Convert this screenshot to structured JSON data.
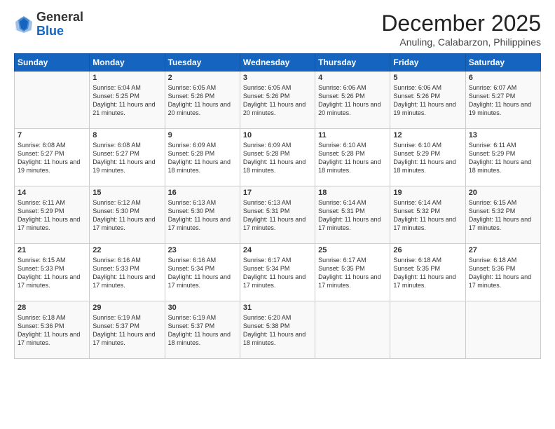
{
  "header": {
    "logo_general": "General",
    "logo_blue": "Blue",
    "month_title": "December 2025",
    "location": "Anuling, Calabarzon, Philippines"
  },
  "columns": [
    "Sunday",
    "Monday",
    "Tuesday",
    "Wednesday",
    "Thursday",
    "Friday",
    "Saturday"
  ],
  "weeks": [
    [
      {
        "day": "",
        "sunrise": "",
        "sunset": "",
        "daylight": ""
      },
      {
        "day": "1",
        "sunrise": "Sunrise: 6:04 AM",
        "sunset": "Sunset: 5:25 PM",
        "daylight": "Daylight: 11 hours and 21 minutes."
      },
      {
        "day": "2",
        "sunrise": "Sunrise: 6:05 AM",
        "sunset": "Sunset: 5:26 PM",
        "daylight": "Daylight: 11 hours and 20 minutes."
      },
      {
        "day": "3",
        "sunrise": "Sunrise: 6:05 AM",
        "sunset": "Sunset: 5:26 PM",
        "daylight": "Daylight: 11 hours and 20 minutes."
      },
      {
        "day": "4",
        "sunrise": "Sunrise: 6:06 AM",
        "sunset": "Sunset: 5:26 PM",
        "daylight": "Daylight: 11 hours and 20 minutes."
      },
      {
        "day": "5",
        "sunrise": "Sunrise: 6:06 AM",
        "sunset": "Sunset: 5:26 PM",
        "daylight": "Daylight: 11 hours and 19 minutes."
      },
      {
        "day": "6",
        "sunrise": "Sunrise: 6:07 AM",
        "sunset": "Sunset: 5:27 PM",
        "daylight": "Daylight: 11 hours and 19 minutes."
      }
    ],
    [
      {
        "day": "7",
        "sunrise": "Sunrise: 6:08 AM",
        "sunset": "Sunset: 5:27 PM",
        "daylight": "Daylight: 11 hours and 19 minutes."
      },
      {
        "day": "8",
        "sunrise": "Sunrise: 6:08 AM",
        "sunset": "Sunset: 5:27 PM",
        "daylight": "Daylight: 11 hours and 19 minutes."
      },
      {
        "day": "9",
        "sunrise": "Sunrise: 6:09 AM",
        "sunset": "Sunset: 5:28 PM",
        "daylight": "Daylight: 11 hours and 18 minutes."
      },
      {
        "day": "10",
        "sunrise": "Sunrise: 6:09 AM",
        "sunset": "Sunset: 5:28 PM",
        "daylight": "Daylight: 11 hours and 18 minutes."
      },
      {
        "day": "11",
        "sunrise": "Sunrise: 6:10 AM",
        "sunset": "Sunset: 5:28 PM",
        "daylight": "Daylight: 11 hours and 18 minutes."
      },
      {
        "day": "12",
        "sunrise": "Sunrise: 6:10 AM",
        "sunset": "Sunset: 5:29 PM",
        "daylight": "Daylight: 11 hours and 18 minutes."
      },
      {
        "day": "13",
        "sunrise": "Sunrise: 6:11 AM",
        "sunset": "Sunset: 5:29 PM",
        "daylight": "Daylight: 11 hours and 18 minutes."
      }
    ],
    [
      {
        "day": "14",
        "sunrise": "Sunrise: 6:11 AM",
        "sunset": "Sunset: 5:29 PM",
        "daylight": "Daylight: 11 hours and 17 minutes."
      },
      {
        "day": "15",
        "sunrise": "Sunrise: 6:12 AM",
        "sunset": "Sunset: 5:30 PM",
        "daylight": "Daylight: 11 hours and 17 minutes."
      },
      {
        "day": "16",
        "sunrise": "Sunrise: 6:13 AM",
        "sunset": "Sunset: 5:30 PM",
        "daylight": "Daylight: 11 hours and 17 minutes."
      },
      {
        "day": "17",
        "sunrise": "Sunrise: 6:13 AM",
        "sunset": "Sunset: 5:31 PM",
        "daylight": "Daylight: 11 hours and 17 minutes."
      },
      {
        "day": "18",
        "sunrise": "Sunrise: 6:14 AM",
        "sunset": "Sunset: 5:31 PM",
        "daylight": "Daylight: 11 hours and 17 minutes."
      },
      {
        "day": "19",
        "sunrise": "Sunrise: 6:14 AM",
        "sunset": "Sunset: 5:32 PM",
        "daylight": "Daylight: 11 hours and 17 minutes."
      },
      {
        "day": "20",
        "sunrise": "Sunrise: 6:15 AM",
        "sunset": "Sunset: 5:32 PM",
        "daylight": "Daylight: 11 hours and 17 minutes."
      }
    ],
    [
      {
        "day": "21",
        "sunrise": "Sunrise: 6:15 AM",
        "sunset": "Sunset: 5:33 PM",
        "daylight": "Daylight: 11 hours and 17 minutes."
      },
      {
        "day": "22",
        "sunrise": "Sunrise: 6:16 AM",
        "sunset": "Sunset: 5:33 PM",
        "daylight": "Daylight: 11 hours and 17 minutes."
      },
      {
        "day": "23",
        "sunrise": "Sunrise: 6:16 AM",
        "sunset": "Sunset: 5:34 PM",
        "daylight": "Daylight: 11 hours and 17 minutes."
      },
      {
        "day": "24",
        "sunrise": "Sunrise: 6:17 AM",
        "sunset": "Sunset: 5:34 PM",
        "daylight": "Daylight: 11 hours and 17 minutes."
      },
      {
        "day": "25",
        "sunrise": "Sunrise: 6:17 AM",
        "sunset": "Sunset: 5:35 PM",
        "daylight": "Daylight: 11 hours and 17 minutes."
      },
      {
        "day": "26",
        "sunrise": "Sunrise: 6:18 AM",
        "sunset": "Sunset: 5:35 PM",
        "daylight": "Daylight: 11 hours and 17 minutes."
      },
      {
        "day": "27",
        "sunrise": "Sunrise: 6:18 AM",
        "sunset": "Sunset: 5:36 PM",
        "daylight": "Daylight: 11 hours and 17 minutes."
      }
    ],
    [
      {
        "day": "28",
        "sunrise": "Sunrise: 6:18 AM",
        "sunset": "Sunset: 5:36 PM",
        "daylight": "Daylight: 11 hours and 17 minutes."
      },
      {
        "day": "29",
        "sunrise": "Sunrise: 6:19 AM",
        "sunset": "Sunset: 5:37 PM",
        "daylight": "Daylight: 11 hours and 17 minutes."
      },
      {
        "day": "30",
        "sunrise": "Sunrise: 6:19 AM",
        "sunset": "Sunset: 5:37 PM",
        "daylight": "Daylight: 11 hours and 18 minutes."
      },
      {
        "day": "31",
        "sunrise": "Sunrise: 6:20 AM",
        "sunset": "Sunset: 5:38 PM",
        "daylight": "Daylight: 11 hours and 18 minutes."
      },
      {
        "day": "",
        "sunrise": "",
        "sunset": "",
        "daylight": ""
      },
      {
        "day": "",
        "sunrise": "",
        "sunset": "",
        "daylight": ""
      },
      {
        "day": "",
        "sunrise": "",
        "sunset": "",
        "daylight": ""
      }
    ]
  ]
}
